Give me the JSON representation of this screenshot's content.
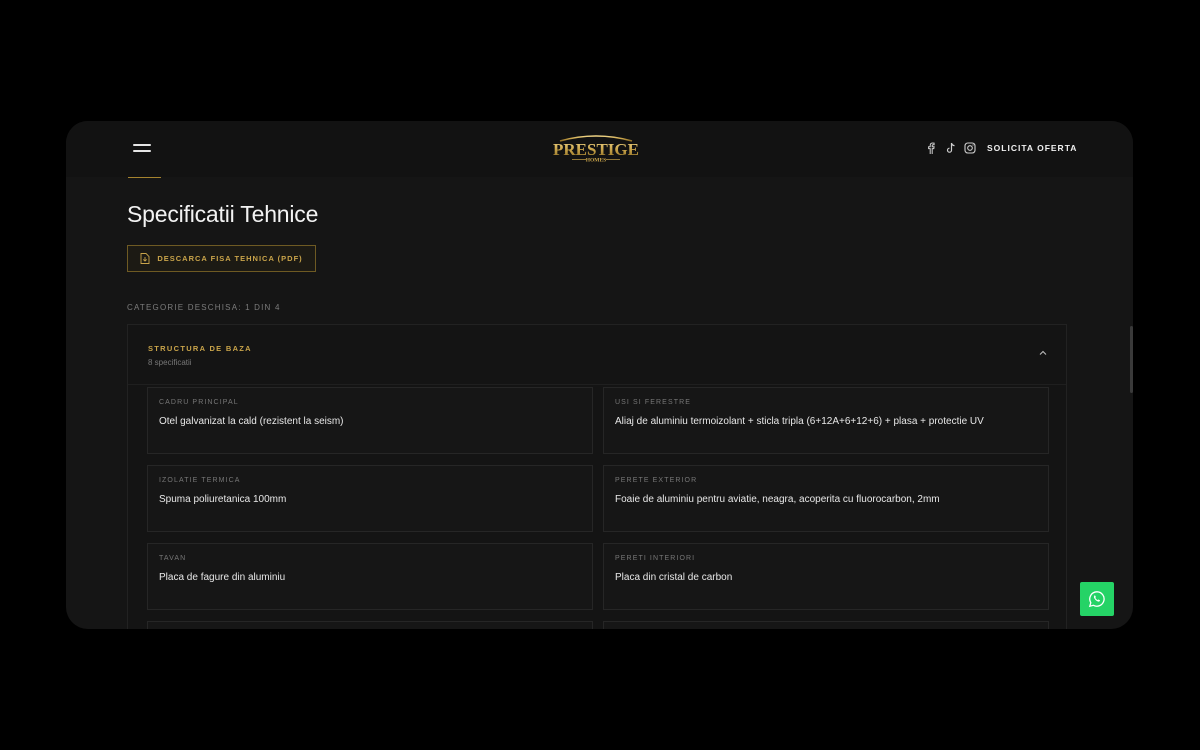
{
  "header": {
    "logo_alt": "PRESTIGE HOMES",
    "social": [
      "facebook-icon",
      "tiktok-icon",
      "instagram-icon"
    ],
    "cta_label": "SOLICITA OFERTA"
  },
  "main": {
    "title": "Specificatii Tehnice",
    "pdf_button_label": "DESCARCA FISA TEHNICA (PDF)",
    "category_counter": "CATEGORIE DESCHISA: 1 DIN 4"
  },
  "accordion": {
    "title": "STRUCTURA DE BAZA",
    "count": "8 specificatii",
    "specs": [
      {
        "label": "CADRU PRINCIPAL",
        "value": "Otel galvanizat la cald (rezistent la seism)"
      },
      {
        "label": "USI SI FERESTRE",
        "value": "Aliaj de aluminiu termoizolant + sticla tripla (6+12A+6+12+6) + plasa + protectie UV"
      },
      {
        "label": "IZOLATIE TERMICA",
        "value": "Spuma poliuretanica 100mm"
      },
      {
        "label": "PERETE EXTERIOR",
        "value": "Foaie de aluminiu pentru aviatie, neagra, acoperita cu fluorocarbon, 2mm"
      },
      {
        "label": "TAVAN",
        "value": "Placa de fagure din aluminiu"
      },
      {
        "label": "PERETI INTERIORI",
        "value": "Placa din cristal de carbon"
      }
    ]
  },
  "colors": {
    "background": "#000000",
    "panel": "#151515",
    "accent_gold": "#c9a44a",
    "whatsapp": "#25d366"
  }
}
